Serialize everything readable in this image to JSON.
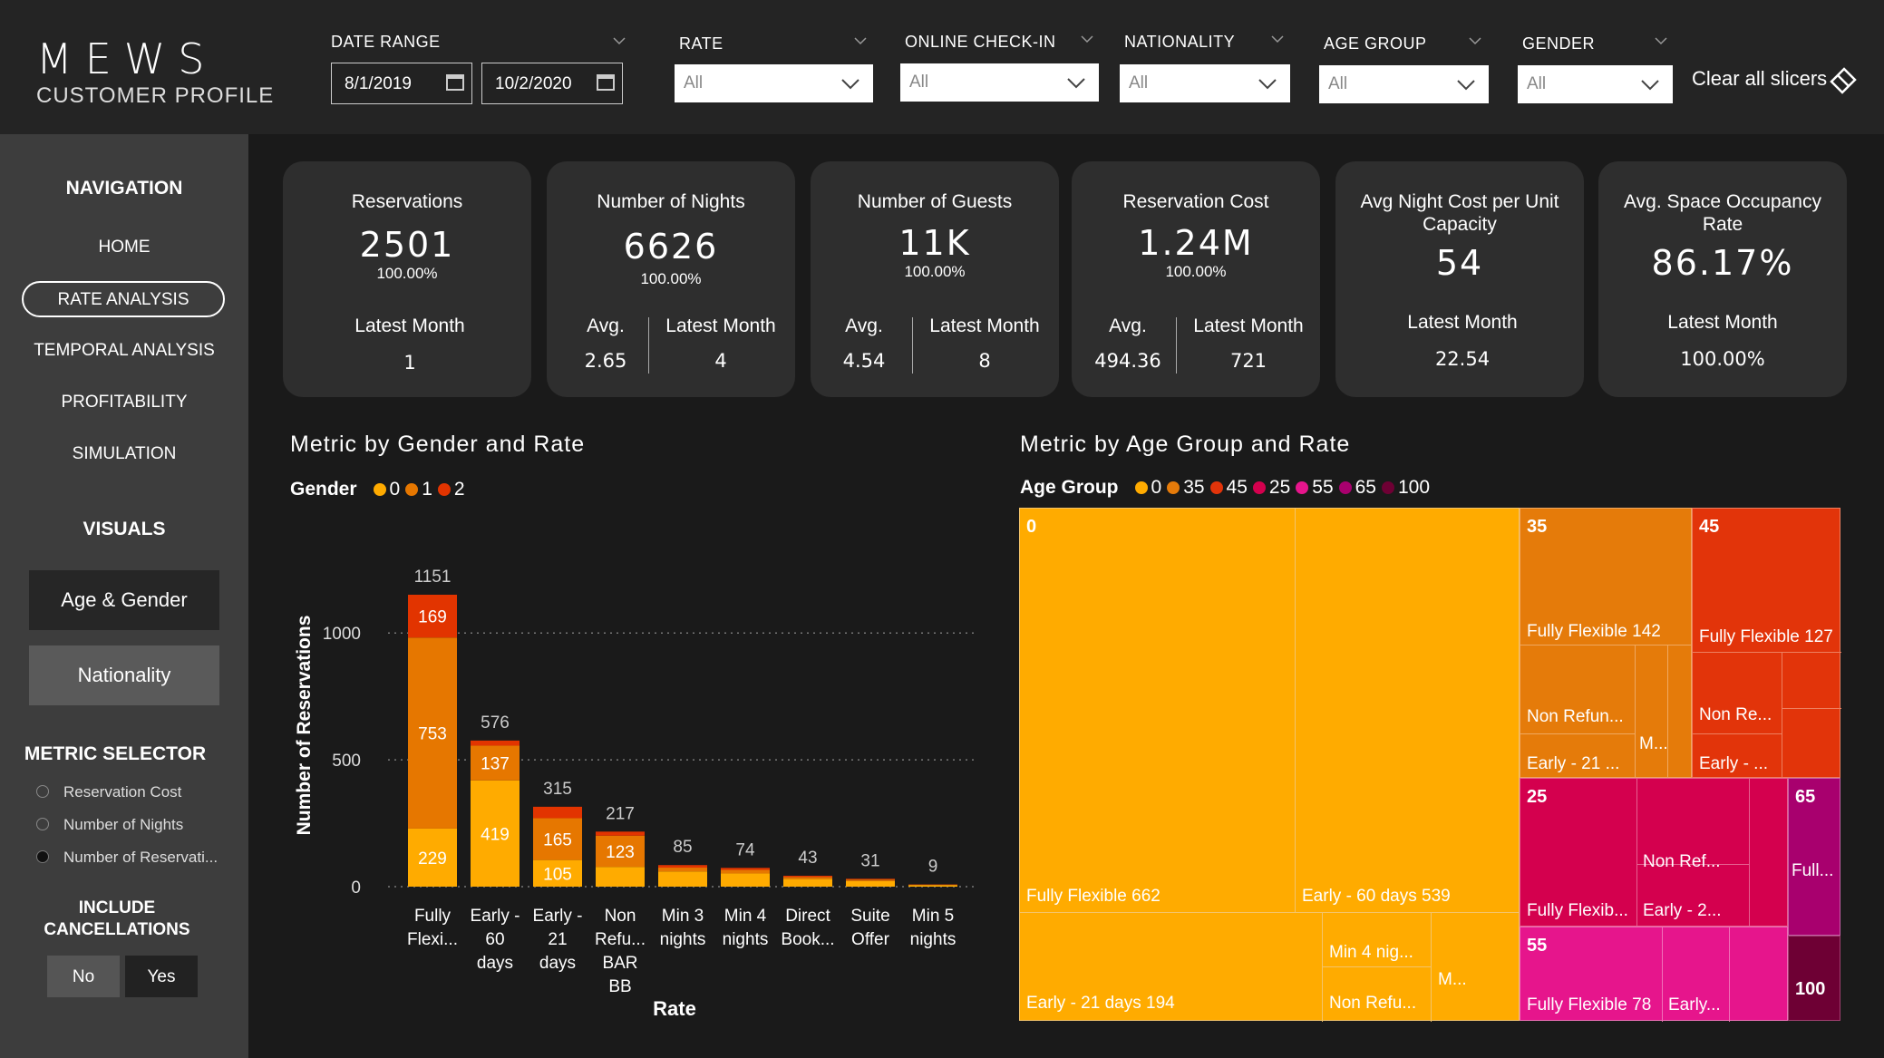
{
  "header": {
    "logo": "MEWS",
    "subtitle": "CUSTOMER PROFILE",
    "date_range": {
      "label": "DATE RANGE",
      "start": "8/1/2019",
      "end": "10/2/2020"
    },
    "slicers": [
      {
        "label": "RATE",
        "value": "All"
      },
      {
        "label": "ONLINE CHECK-IN",
        "value": "All"
      },
      {
        "label": "NATIONALITY",
        "value": "All"
      },
      {
        "label": "AGE GROUP",
        "value": "All"
      },
      {
        "label": "GENDER",
        "value": "All"
      }
    ],
    "clear_label": "Clear all slicers"
  },
  "sidebar": {
    "nav_title": "NAVIGATION",
    "nav_items": [
      "HOME",
      "RATE ANALYSIS",
      "TEMPORAL ANALYSIS",
      "PROFITABILITY",
      "SIMULATION"
    ],
    "active_nav": "RATE ANALYSIS",
    "visuals_title": "VISUALS",
    "visual_buttons": [
      "Age & Gender",
      "Nationality"
    ],
    "metric_title": "METRIC SELECTOR",
    "metric_options": [
      "Reservation Cost",
      "Number of Nights",
      "Number of Reservati..."
    ],
    "metric_selected": "Number of Reservati...",
    "include_title_1": "INCLUDE",
    "include_title_2": "CANCELLATIONS",
    "include_options": [
      "No",
      "Yes"
    ]
  },
  "kpis": [
    {
      "title": "Reservations",
      "value": "2501",
      "pct": "100.00%",
      "avg_label": "",
      "avg_value": "",
      "latest_label": "Latest Month",
      "latest_value": "1"
    },
    {
      "title": "Number of Nights",
      "value": "6626",
      "pct": "100.00%",
      "avg_label": "Avg.",
      "avg_value": "2.65",
      "latest_label": "Latest Month",
      "latest_value": "4"
    },
    {
      "title": "Number of Guests",
      "value": "11K",
      "pct": "100.00%",
      "avg_label": "Avg.",
      "avg_value": "4.54",
      "latest_label": "Latest Month",
      "latest_value": "8"
    },
    {
      "title": "Reservation Cost",
      "value": "1.24M",
      "pct": "100.00%",
      "avg_label": "Avg.",
      "avg_value": "494.36",
      "latest_label": "Latest Month",
      "latest_value": "721"
    },
    {
      "title": "Avg Night Cost per Unit Capacity",
      "title_line1": "Avg Night Cost per Unit",
      "title_line2": "Capacity",
      "value": "54",
      "latest_label": "Latest Month",
      "latest_value": "22.54"
    },
    {
      "title": "Avg. Space Occupancy Rate",
      "title_line1": "Avg. Space Occupancy",
      "title_line2": "Rate",
      "value": "86.17%",
      "latest_label": "Latest Month",
      "latest_value": "100.00%"
    }
  ],
  "colors": {
    "g0": "#FFAB00",
    "g1": "#E67700",
    "g2": "#E23400",
    "a0": "#FFAB00",
    "a35": "#E57B0A",
    "a45": "#E2340A",
    "a25": "#D4004E",
    "a55": "#E6158C",
    "a65": "#A8006E",
    "a100": "#6E0034"
  },
  "chart_data": [
    {
      "type": "bar",
      "title": "Metric by Gender and Rate",
      "legend_title": "Gender",
      "xlabel": "Rate",
      "ylabel": "Number of Reservations",
      "ylim": [
        0,
        1151
      ],
      "yticks": [
        0,
        500,
        1000
      ],
      "grid": true,
      "categories": [
        [
          "Fully",
          "Flexi..."
        ],
        [
          "Early -",
          "60",
          "days"
        ],
        [
          "Early -",
          "21",
          "days"
        ],
        [
          "Non",
          "Refu...",
          "BAR",
          "BB"
        ],
        [
          "Min 3",
          "nights"
        ],
        [
          "Min 4",
          "nights"
        ],
        [
          "Direct",
          "Book..."
        ],
        [
          "Suite",
          "Offer"
        ],
        [
          "Min 5",
          "nights"
        ]
      ],
      "series": [
        {
          "name": "0",
          "values": [
            229,
            419,
            105,
            78,
            60,
            52,
            30,
            22,
            6
          ]
        },
        {
          "name": "1",
          "values": [
            753,
            137,
            165,
            123,
            15,
            14,
            8,
            6,
            2
          ]
        },
        {
          "name": "2",
          "values": [
            169,
            20,
            45,
            16,
            10,
            8,
            5,
            3,
            1
          ]
        }
      ],
      "totals": [
        1151,
        576,
        315,
        217,
        85,
        74,
        43,
        31,
        9
      ],
      "segment_labels": [
        [
          "229",
          "753",
          "169"
        ],
        [
          "419",
          "137",
          ""
        ],
        [
          "105",
          "165",
          ""
        ],
        [
          "",
          "123",
          ""
        ],
        [
          "",
          "",
          ""
        ],
        [
          "",
          "",
          ""
        ],
        [
          "",
          "",
          ""
        ],
        [
          "",
          "",
          ""
        ],
        [
          "",
          "",
          ""
        ]
      ]
    },
    {
      "type": "treemap",
      "title": "Metric by Age Group and Rate",
      "legend_title": "Age Group",
      "legend": [
        "0",
        "35",
        "45",
        "25",
        "55",
        "65",
        "100"
      ],
      "groups": [
        {
          "name": "0",
          "children": [
            {
              "label": "Fully Flexible 662"
            },
            {
              "label": "Early - 60 days 539"
            },
            {
              "label": "Early - 21 days 194"
            },
            {
              "label": "Min 4 nig..."
            },
            {
              "label": "Non Refu..."
            },
            {
              "label": "M..."
            }
          ]
        },
        {
          "name": "35",
          "children": [
            {
              "label": "Fully Flexible 142"
            },
            {
              "label": "Non Refun..."
            },
            {
              "label": "Early - 21 ..."
            },
            {
              "label": "M..."
            }
          ]
        },
        {
          "name": "45",
          "children": [
            {
              "label": "Fully Flexible 127"
            },
            {
              "label": "Non Re..."
            },
            {
              "label": "Early - ..."
            }
          ]
        },
        {
          "name": "25",
          "children": [
            {
              "label": "Fully Flexib..."
            },
            {
              "label": "Non Ref..."
            },
            {
              "label": "Early - 2..."
            }
          ]
        },
        {
          "name": "55",
          "children": [
            {
              "label": "Fully Flexible 78"
            },
            {
              "label": "Early..."
            }
          ]
        },
        {
          "name": "65",
          "children": [
            {
              "label": "Full..."
            }
          ]
        },
        {
          "name": "100",
          "children": []
        }
      ]
    }
  ]
}
